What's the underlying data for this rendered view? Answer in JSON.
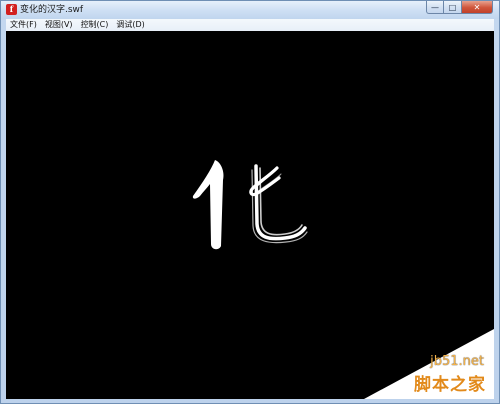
{
  "window": {
    "title": "变化的汉字.swf",
    "app_icon_letter": "f",
    "controls": {
      "minimize": "—",
      "maximize": "□",
      "close": "✕"
    }
  },
  "menu": {
    "items": [
      {
        "label": "文件(F)"
      },
      {
        "label": "视图(V)"
      },
      {
        "label": "控制(C)"
      },
      {
        "label": "调试(D)"
      }
    ]
  },
  "stage": {
    "background": "#000000",
    "glyph_color": "#ffffff"
  },
  "watermark": {
    "site": "jb51.net",
    "brand": "脚本之家",
    "color": "#e28a1b"
  }
}
